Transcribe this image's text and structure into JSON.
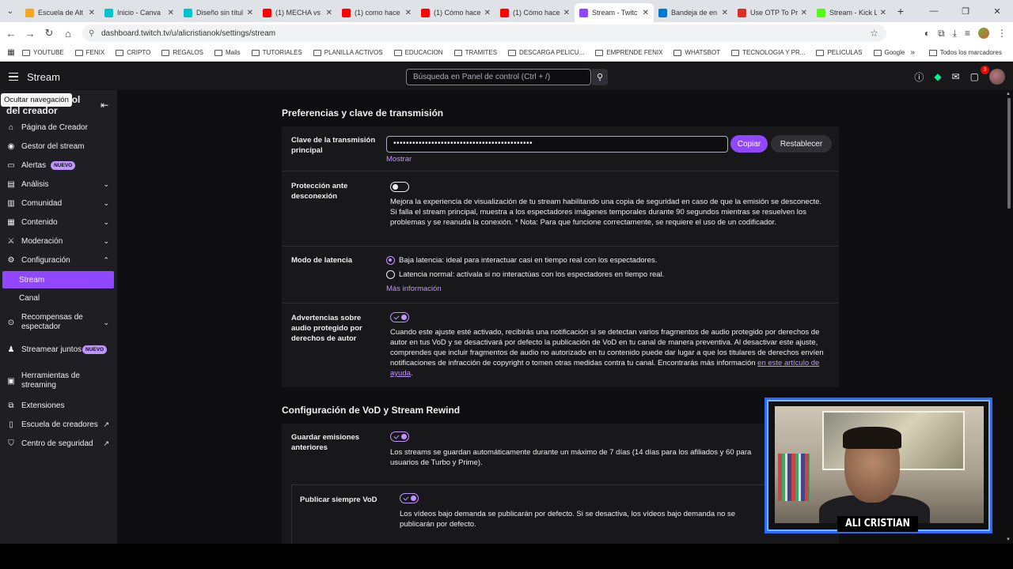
{
  "browser": {
    "tabs": [
      {
        "title": "Escuela de Alt",
        "color": "#f5a623"
      },
      {
        "title": "Inicio - Canva",
        "color": "#00c4cc"
      },
      {
        "title": "Diseño sin títul",
        "color": "#00c4cc"
      },
      {
        "title": "(1) MECHA vs",
        "color": "#ff0000"
      },
      {
        "title": "(1) como hace",
        "color": "#ff0000"
      },
      {
        "title": "(1) Cómo hace",
        "color": "#ff0000"
      },
      {
        "title": "(1) Cómo hace",
        "color": "#ff0000"
      },
      {
        "title": "Stream - Twitc",
        "color": "#9147ff",
        "active": true
      },
      {
        "title": "Bandeja de en",
        "color": "#0078d4"
      },
      {
        "title": "Use OTP To Pr",
        "color": "#d93025"
      },
      {
        "title": "Stream - Kick L",
        "color": "#53fc18"
      }
    ],
    "url": "dashboard.twitch.tv/u/alicristianok/settings/stream",
    "bookmarks": [
      "YOUTUBE",
      "FENIX",
      "CRIPTO",
      "REGALOS",
      "Mails",
      "TUTORIALES",
      "PLANILLA ACTIVOS",
      "EDUCACION",
      "TRAMITES",
      "DESCARGA PELICU...",
      "EMPRENDE FENIX",
      "WHATSBOT",
      "TECNOLOGIA Y PR...",
      "PELICULAS",
      "Google"
    ],
    "bookmarks_all": "Todos los marcadores"
  },
  "topnav": {
    "brand": "Stream",
    "search_placeholder": "Búsqueda en Panel de control (Ctrl + /)",
    "notif_count": "3"
  },
  "sidebar": {
    "title": "Panel de control del creador",
    "tooltip": "Ocultar navegación",
    "items": [
      {
        "label": "Página de Creador",
        "icon": "⌂"
      },
      {
        "label": "Gestor del stream",
        "icon": "◉"
      },
      {
        "label": "Alertas",
        "icon": "▭",
        "badge": "NUEVO"
      },
      {
        "label": "Análisis",
        "icon": "▤",
        "chevron": "⌄"
      },
      {
        "label": "Comunidad",
        "icon": "▥",
        "chevron": "⌄"
      },
      {
        "label": "Contenido",
        "icon": "▦",
        "chevron": "⌄"
      },
      {
        "label": "Moderación",
        "icon": "⚔",
        "chevron": "⌄"
      },
      {
        "label": "Configuración",
        "icon": "⚙",
        "chevron": "⌃"
      }
    ],
    "sub_items": [
      {
        "label": "Stream",
        "active": true
      },
      {
        "label": "Canal"
      }
    ],
    "items2": [
      {
        "label": "Recompensas de espectador",
        "icon": "⊙",
        "chevron": "⌄"
      },
      {
        "label": "Streamear juntos",
        "icon": "♟",
        "badge": "NUEVO"
      },
      {
        "label": "Herramientas de streaming",
        "icon": "▣"
      },
      {
        "label": "Extensiones",
        "icon": "⧉"
      },
      {
        "label": "Escuela de creadores",
        "icon": "▯",
        "ext": "↗"
      },
      {
        "label": "Centro de seguridad",
        "icon": "⛉",
        "ext": "↗"
      }
    ]
  },
  "main": {
    "section1_title": "Preferencias y clave de transmisión",
    "key": {
      "label": "Clave de la transmisión principal",
      "value": "••••••••••••••••••••••••••••••••••••••••••••",
      "copy": "Copiar",
      "reset": "Restablecer",
      "show": "Mostrar"
    },
    "disconnect": {
      "label": "Protección ante desconexión",
      "enabled": false,
      "desc": "Mejora la experiencia de visualización de tu stream habilitando una copia de seguridad en caso de que la emisión se desconecte. Si falla el stream principal, muestra a los espectadores imágenes temporales durante 90 segundos mientras se resuelven los problemas y se reanuda la conexión. * Nota: Para que funcione correctamente, se requiere el uso de un codificador."
    },
    "latency": {
      "label": "Modo de latencia",
      "option1": "Baja latencia: ideal para interactuar casi en tiempo real con los espectadores.",
      "option2": "Latencia normal: actívala si no interactúas con los espectadores en tiempo real.",
      "more": "Más información",
      "selected": 1
    },
    "copyright": {
      "label": "Advertencias sobre audio protegido por derechos de autor",
      "enabled": true,
      "desc": "Cuando este ajuste esté activado, recibirás una notificación si se detectan varios fragmentos de audio protegido por derechos de autor en tus VoD y se desactivará por defecto la publicación de VoD en tu canal de manera preventiva. Al desactivar este ajuste, comprendes que incluir fragmentos de audio no autorizado en tu contenido puede dar lugar a que los titulares de derechos envíen notificaciones de infracción de copyright o tomen otras medidas contra tu canal. Encontrarás más información ",
      "link": "en este artículo de ayuda",
      "end": "."
    },
    "section2_title": "Configuración de VoD y Stream Rewind",
    "save_past": {
      "label": "Guardar emisiones anteriores",
      "enabled": true,
      "desc": "Los streams se guardan automáticamente durante un máximo de 7 días (14 días para los afiliados y 60 para usuarios de Turbo y Prime)."
    },
    "publish_vod": {
      "label": "Publicar siempre VoD",
      "enabled": true,
      "desc": "Los vídeos bajo demanda se publicarán por defecto. Si se desactiva, los vídeos bajo demanda no se publicarán por defecto."
    }
  },
  "webcam": {
    "name": "ALI CRISTIAN"
  }
}
